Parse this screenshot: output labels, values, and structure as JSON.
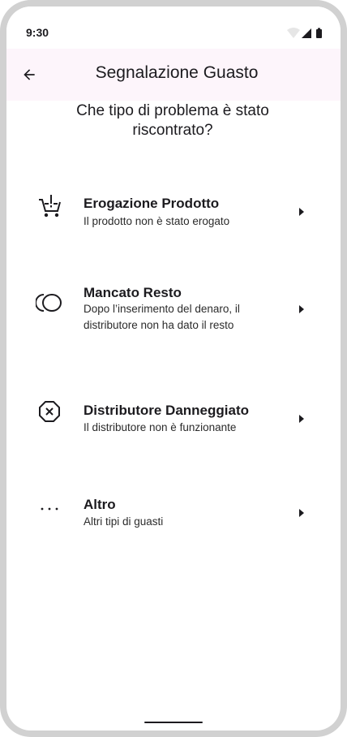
{
  "status_bar": {
    "time": "9:30",
    "icons": [
      "wifi-icon",
      "signal-icon",
      "battery-icon"
    ]
  },
  "top_bar": {
    "back_icon": "arrow-back-icon",
    "title": "Segnalazione Guasto"
  },
  "question": "Che tipo di problema è stato riscontrato?",
  "options": [
    {
      "icon": "cart-alert-icon",
      "title": "Erogazione Prodotto",
      "description": "Il prodotto non è stato erogato"
    },
    {
      "icon": "coins-icon",
      "title": "Mancato Resto",
      "description": "Dopo l’inserimento del denaro, il distributore non ha dato il resto"
    },
    {
      "icon": "octagon-x-icon",
      "title": "Distributore Danneggiato",
      "description": "Il distributore non è funzionante"
    },
    {
      "icon": "more-horiz-icon",
      "title": "Altro",
      "description": "Altri tipi di guasti"
    }
  ],
  "colors": {
    "top_bar_background": "#fdf5fb",
    "text_primary": "#1c1b1f",
    "device_frame": "#d1d1d1"
  }
}
